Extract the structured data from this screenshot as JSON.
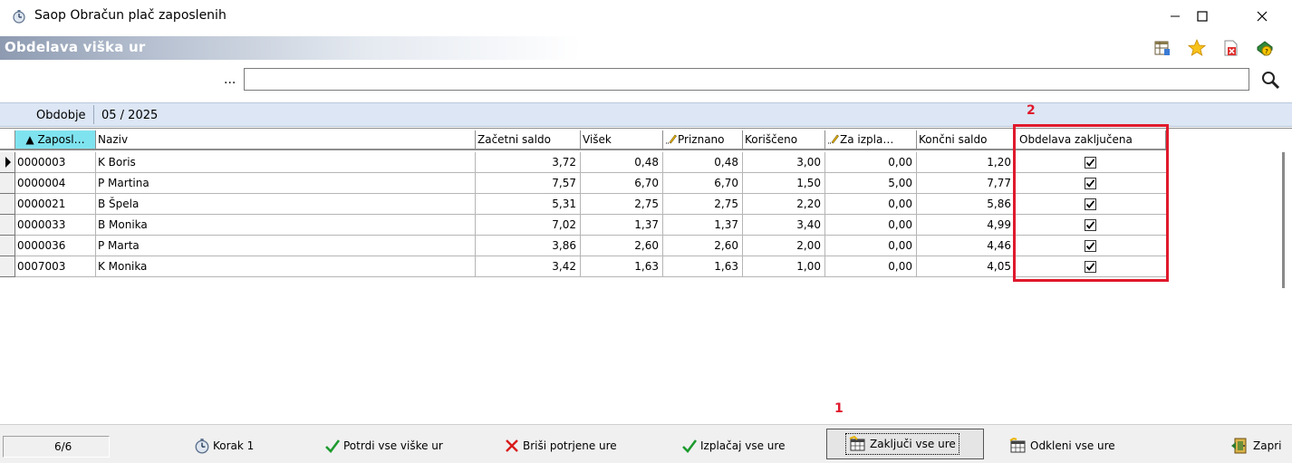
{
  "window": {
    "title": "Saop Obračun plač zaposlenih",
    "app_icon": "stopwatch-icon",
    "controls": {
      "minimize": "minimize-icon",
      "maximize": "maximize-icon",
      "close": "close-icon"
    }
  },
  "module": {
    "title": "Obdelava viška ur",
    "toolbar_icons": [
      "table-settings-icon",
      "favorites-star-icon",
      "close-module-icon",
      "help-icon"
    ]
  },
  "search": {
    "ellipsis": "...",
    "value": "",
    "icon": "search-icon"
  },
  "period": {
    "label": "Obdobje",
    "value": "05 / 2025"
  },
  "grid": {
    "columns": [
      {
        "label": "▲ Zaposl…",
        "sorted": true
      },
      {
        "label": "Naziv"
      },
      {
        "label": "Začetni saldo"
      },
      {
        "label": "Višek"
      },
      {
        "label": "Priznano",
        "editable_icon": "pencil-icon"
      },
      {
        "label": "Koriščeno"
      },
      {
        "label": "Za izpla…",
        "editable_icon": "pencil-icon"
      },
      {
        "label": "Končni saldo"
      },
      {
        "label": "Obdelava zaključena"
      }
    ],
    "rows": [
      {
        "id": "0000003",
        "name": "K Boris",
        "zacetni": "3,72",
        "visek": "0,48",
        "priznano": "0,48",
        "korisceno": "3,00",
        "za_izplacilo": "0,00",
        "koncni": "1,20",
        "zakljucena": true,
        "current": true
      },
      {
        "id": "0000004",
        "name": "P Martina",
        "zacetni": "7,57",
        "visek": "6,70",
        "priznano": "6,70",
        "korisceno": "1,50",
        "za_izplacilo": "5,00",
        "koncni": "7,77",
        "zakljucena": true
      },
      {
        "id": "0000021",
        "name": "B Špela",
        "zacetni": "5,31",
        "visek": "2,75",
        "priznano": "2,75",
        "korisceno": "2,20",
        "za_izplacilo": "0,00",
        "koncni": "5,86",
        "zakljucena": true
      },
      {
        "id": "0000033",
        "name": "B Monika",
        "zacetni": "7,02",
        "visek": "1,37",
        "priznano": "1,37",
        "korisceno": "3,40",
        "za_izplacilo": "0,00",
        "koncni": "4,99",
        "zakljucena": true
      },
      {
        "id": "0000036",
        "name": "P Marta",
        "zacetni": "3,86",
        "visek": "2,60",
        "priznano": "2,60",
        "korisceno": "2,00",
        "za_izplacilo": "0,00",
        "koncni": "4,46",
        "zakljucena": true
      },
      {
        "id": "0007003",
        "name": "K Monika",
        "zacetni": "3,42",
        "visek": "1,63",
        "priznano": "1,63",
        "korisceno": "1,00",
        "za_izplacilo": "0,00",
        "koncni": "4,05",
        "zakljucena": true
      }
    ]
  },
  "annotations": {
    "marker_1": "1",
    "marker_2": "2",
    "color": "#e0192c"
  },
  "statusbar": {
    "counter": "6/6",
    "buttons": [
      {
        "label": "Korak 1",
        "icon": "stopwatch-icon"
      },
      {
        "label": "Potrdi vse viške ur",
        "icon": "green-check-icon"
      },
      {
        "label": "Briši potrjene ure",
        "icon": "red-x-icon"
      },
      {
        "label": "Izplačaj vse ure",
        "icon": "green-check-icon"
      },
      {
        "label": "Zaključi vse ure",
        "icon": "lock-calendar-icon",
        "focused": true
      },
      {
        "label": "Odkleni vse ure",
        "icon": "unlock-calendar-icon"
      },
      {
        "label": "Zapri",
        "icon": "exit-door-icon"
      }
    ]
  }
}
